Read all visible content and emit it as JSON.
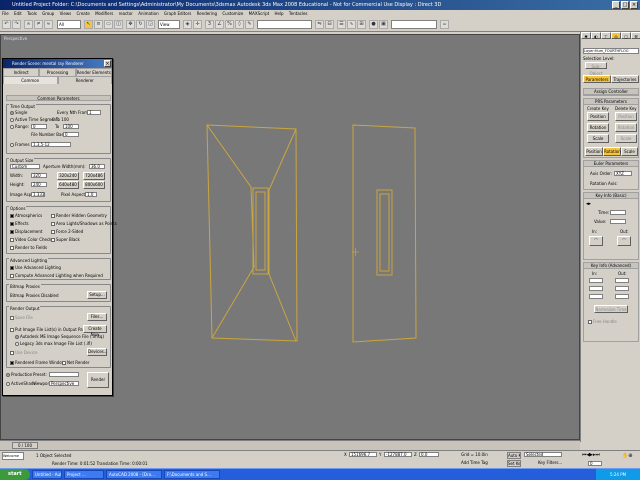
{
  "window": {
    "title": "Untitled   Project Folder: C:\\Documents and Settings\\Administrator\\My Documents\\3dsmax    Autodesk 3ds Max 2008   Educational - Not for Commercial Use     Display : Direct 3D"
  },
  "menu": [
    "File",
    "Edit",
    "Tools",
    "Group",
    "Views",
    "Create",
    "Modifiers",
    "reactor",
    "Animation",
    "Graph Editors",
    "Rendering",
    "Customize",
    "MAXScript",
    "Help",
    "Tentacles"
  ],
  "toolbar": {
    "selection_filter": "All",
    "view_combo": "View",
    "selection_set": ""
  },
  "viewport": {
    "label": "Perspective"
  },
  "command_panel": {
    "object_name": "Layer:Hum_FOURTHFLOO",
    "selection_level_label": "Selection Level:",
    "sub_object_btn": "Sub-Object",
    "tab_parameters": "Parameters",
    "tab_trajectories": "Trajectories",
    "assign_controller": "Assign Controller",
    "prs_header": "PRS Parameters",
    "create_key": "Create Key",
    "delete_key": "Delete Key",
    "position": "Position",
    "rotation": "Rotation",
    "scale": "Scale",
    "tab_position": "Position",
    "tab_rotation": "Rotation",
    "tab_scale": "Scale",
    "euler_header": "Euler Parameters",
    "axis_order_label": "Axis Order:",
    "axis_order_value": "XYZ",
    "rotation_axis_label": "Rotation Axis:",
    "key_info_basic": "Key Info (Basic)",
    "time_label": "Time:",
    "value_label": "Value:",
    "in_label": "In:",
    "out_label": "Out:",
    "key_info_adv": "Key Info (Advanced)",
    "normalize_time": "Normalize Time",
    "free_handle": "Free Handle"
  },
  "render_dialog": {
    "title": "Render Scene: mental ray Renderer",
    "tabs_row1": [
      "Indirect Illumination",
      "Processing",
      "Render Elements"
    ],
    "tabs_row2": [
      "Common",
      "Renderer"
    ],
    "common_params": "Common Parameters",
    "time_output": "Time Output",
    "single": "Single",
    "every_nth": "Every Nth Frame:",
    "every_nth_val": "1",
    "active_segment": "Active Time Segment:",
    "active_range": "0 To 100",
    "range": "Range:",
    "range_from": "0",
    "range_to_label": "To",
    "range_to": "100",
    "file_number_base": "File Number Base:",
    "file_number_val": "0",
    "frames": "Frames",
    "frames_val": "1,3,5-12",
    "output_size": "Output Size",
    "output_preset": "Custom",
    "aperture_label": "Aperture Width(mm):",
    "aperture_val": "36.0",
    "width_label": "Width:",
    "width_val": "320",
    "height_label": "Height:",
    "height_val": "240",
    "preset1": "320x240",
    "preset2": "720x486",
    "preset3": "640x480",
    "preset4": "800x600",
    "image_aspect": "Image Aspect:",
    "image_aspect_val": "1.333",
    "pixel_aspect": "Pixel Aspect:",
    "pixel_aspect_val": "1.0",
    "options": "Options",
    "opt_atmospherics": "Atmospherics",
    "opt_render_hidden": "Render Hidden Geometry",
    "opt_effects": "Effects",
    "opt_area_lights": "Area Lights/Shadows as Points",
    "opt_displacement": "Displacement",
    "opt_force_2sided": "Force 2-Sided",
    "opt_video_color": "Video Color Check",
    "opt_super_black": "Super Black",
    "opt_render_fields": "Render to Fields",
    "adv_lighting": "Advanced Lighting",
    "use_adv_lighting": "Use Advanced Lighting",
    "compute_adv": "Compute Advanced Lighting when Required",
    "bitmap_proxies": "Bitmap Proxies",
    "bitmap_disabled": "Bitmap Proxies Disabled",
    "setup_btn": "Setup...",
    "render_output": "Render Output",
    "save_file": "Save File",
    "files_btn": "Files...",
    "put_image": "Put Image File List(s) in Output Path(s)",
    "create_now": "Create Now",
    "autodesk_me": "Autodesk ME Image Sequence File (.imsq)",
    "legacy": "Legacy 3ds max Image File List (.ifl)",
    "use_device": "Use Device",
    "devices_btn": "Devices...",
    "rendered_frame_window": "Rendered Frame Window",
    "net_render": "Net Render",
    "production": "Production",
    "preset_label": "Preset:",
    "activeshade": "ActiveShade",
    "viewport_label": "Viewport:",
    "viewport_val": "Perspective",
    "render_btn": "Render"
  },
  "timeline": {
    "frame": "0 / 100"
  },
  "status": {
    "selected": "1 Object Selected",
    "prompt": "Render Time: 0:01:52    Translation Time: 0:00:01",
    "x": "151696.7",
    "y": "-127887.0",
    "z": "0.0",
    "grid": "Grid = 10.0in",
    "auto_key": "Auto Key",
    "set_key": "Set Key",
    "selected_dd": "Selected",
    "key_filters": "Key Filters...",
    "add_time_tag": "Add Time Tag",
    "listener": "Welcome to M",
    "frame_field": "0"
  },
  "taskbar": {
    "start": "start",
    "items": [
      "Untitled - Autod...",
      "Project ...",
      "AutoCAD 2008 - [Dra...",
      "F:\\Documents and S..."
    ],
    "clock": "5:24 PM"
  },
  "colors": {
    "accent_yellow": "#c9a640",
    "viewport_bg": "#787878",
    "titlebar": "#0a246a"
  }
}
